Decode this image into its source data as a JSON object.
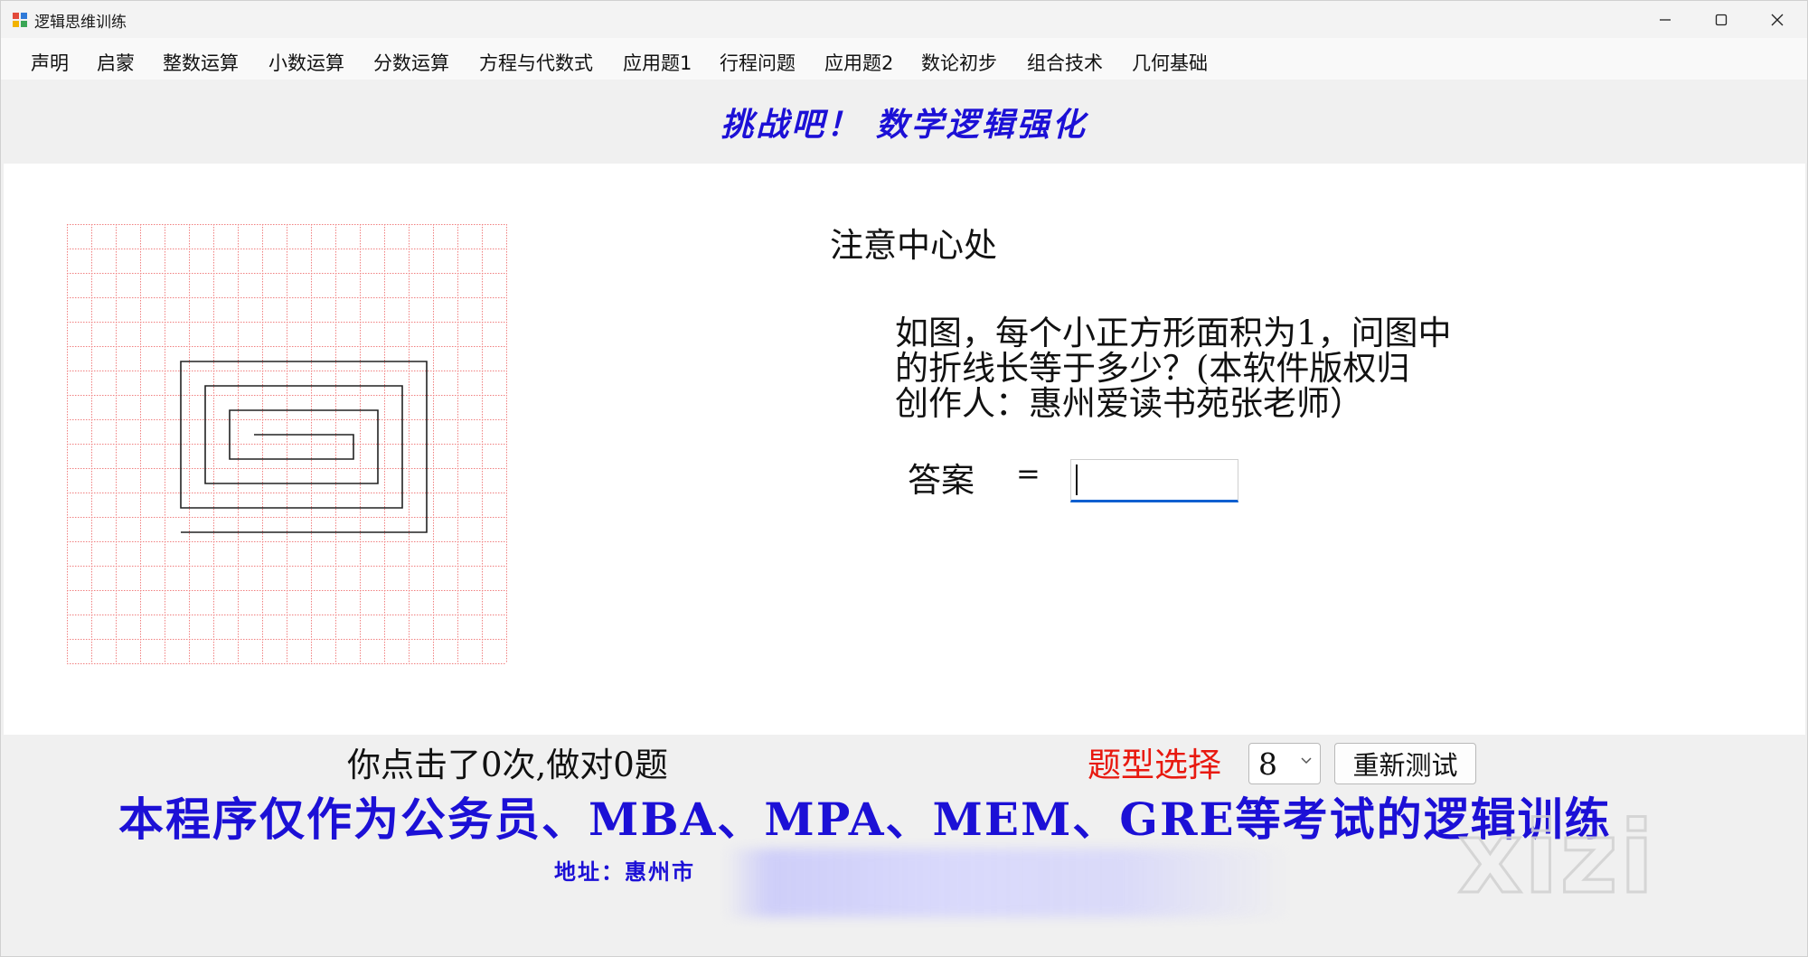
{
  "window": {
    "title": "逻辑思维训练",
    "controls": {
      "minimize": "minimize-icon",
      "maximize": "maximize-icon",
      "close": "close-icon"
    }
  },
  "menu": {
    "items": [
      "声明",
      "启蒙",
      "整数运算",
      "小数运算",
      "分数运算",
      "方程与代数式",
      "应用题1",
      "行程问题",
      "应用题2",
      "数论初步",
      "组合技术",
      "几何基础"
    ]
  },
  "header": {
    "banner": "挑战吧！ 数学逻辑强化"
  },
  "main": {
    "hint": "注意中心处",
    "question_lines": [
      "如图，每个小正方形面积为1，问图中",
      "的折线长等于多少？(本软件版权归",
      "创作人：惠州爱读书苑张老师）"
    ],
    "answer_label": "答案",
    "equals": "=",
    "answer_value": ""
  },
  "status": {
    "click_count": "你点击了0次,做对0题",
    "type_label": "题型选择",
    "type_value": "8",
    "retest_label": "重新测试"
  },
  "footer": {
    "banner": "本程序仅作为公务员、MBA、MPA、MEM、GRE等考试的逻辑训练",
    "address": "地址：惠州市"
  },
  "watermark": "xizi",
  "colors": {
    "banner_blue": "#1c10d6",
    "grid_red": "#f08080",
    "label_red": "#e8190f",
    "focus_blue": "#0a5fd0"
  }
}
